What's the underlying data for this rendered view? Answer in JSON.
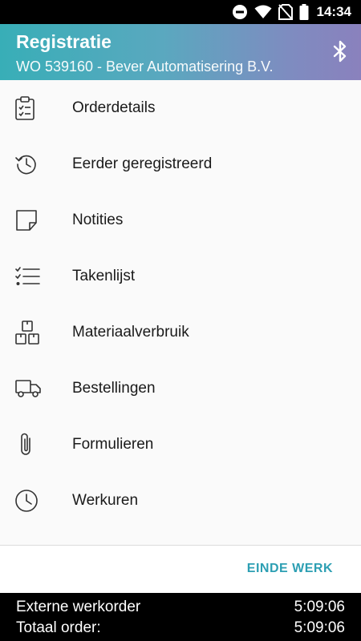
{
  "status_bar": {
    "time": "14:34",
    "icons": [
      "do-not-disturb-icon",
      "wifi-icon",
      "no-sim-icon",
      "battery-icon"
    ]
  },
  "app_bar": {
    "title": "Registratie",
    "subtitle": "WO 539160 - Bever Automatisering B.V.",
    "action_icon": "bluetooth-icon"
  },
  "menu": {
    "items": [
      {
        "label": "Orderdetails",
        "icon": "clipboard-icon"
      },
      {
        "label": "Eerder geregistreerd",
        "icon": "history-icon"
      },
      {
        "label": "Notities",
        "icon": "note-icon"
      },
      {
        "label": "Takenlijst",
        "icon": "checklist-icon"
      },
      {
        "label": "Materiaalverbruik",
        "icon": "boxes-icon"
      },
      {
        "label": "Bestellingen",
        "icon": "truck-icon"
      },
      {
        "label": "Formulieren",
        "icon": "paperclip-icon"
      },
      {
        "label": "Werkuren",
        "icon": "clock-icon"
      }
    ]
  },
  "actions": {
    "end_work": "EINDE WERK"
  },
  "footer": {
    "external_label": "Externe werkorder",
    "external_value": "5:09:06",
    "total_label": "Totaal order:",
    "total_value": "5:09:06"
  },
  "colors": {
    "accent": "#2d9fb3",
    "header_start": "#38aeb7",
    "header_end": "#8a81bd"
  }
}
